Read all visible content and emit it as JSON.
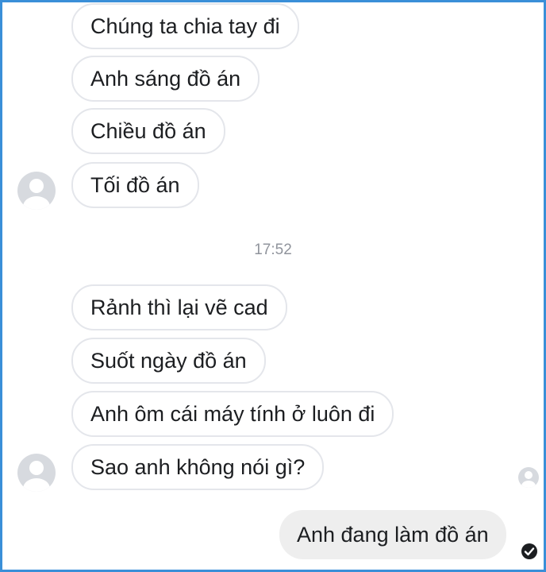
{
  "messages_group_1": [
    {
      "text": "Chúng ta chia tay đi"
    },
    {
      "text": "Anh sáng đồ án"
    },
    {
      "text": "Chiều đồ án"
    },
    {
      "text": "Tối đồ án"
    }
  ],
  "timestamp": "17:52",
  "messages_group_2": [
    {
      "text": "Rảnh thì lại vẽ cad"
    },
    {
      "text": "Suốt ngày đồ án"
    },
    {
      "text": "Anh ôm cái máy tính ở luôn đi"
    },
    {
      "text": "Sao anh không nói gì?"
    }
  ],
  "sent_message": {
    "text": "Anh đang làm đồ án"
  },
  "colors": {
    "frame": "#3a8fd8",
    "incoming_border": "#e4e6eb",
    "outgoing_bg": "#eeeeee",
    "timestamp": "#90949c"
  },
  "icons": {
    "avatar": "default-user-avatar-icon",
    "seen": "seen-avatar-icon",
    "delivered": "delivered-check-icon"
  }
}
